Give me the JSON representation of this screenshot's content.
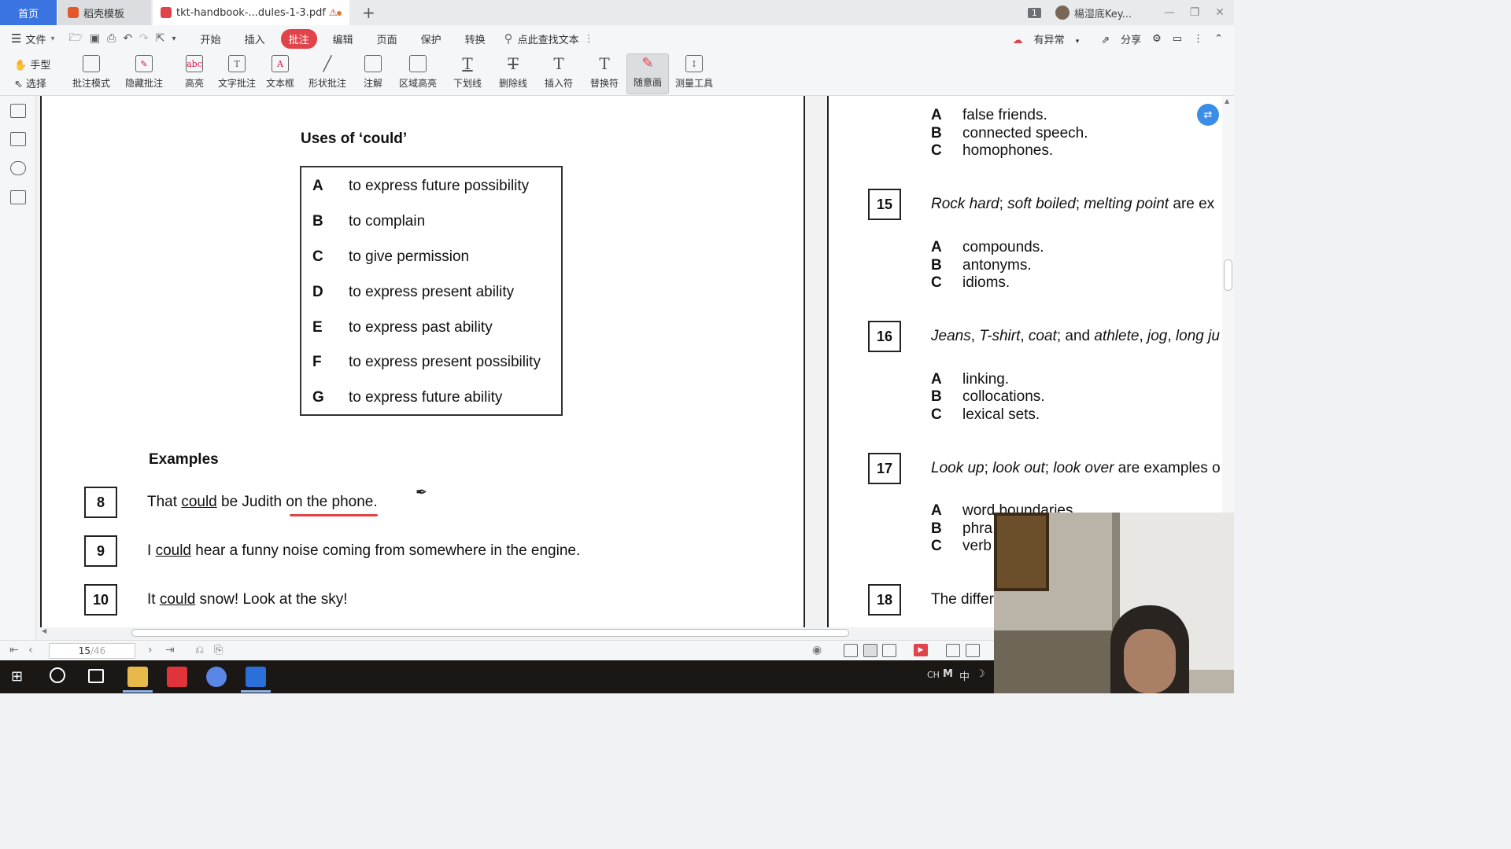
{
  "tabs": {
    "home": "首页",
    "template": "稻壳模板",
    "pdf": "tkt-handbook-...dules-1-3.pdf"
  },
  "window": {
    "count_badge": "1",
    "user_name": "楊湿底Key..."
  },
  "menu": {
    "file": "文件",
    "tabs": [
      "开始",
      "插入",
      "批注",
      "编辑",
      "页面",
      "保护",
      "转换"
    ],
    "active_tab": "批注",
    "search_placeholder": "点此查找文本",
    "right": {
      "status": "有异常",
      "share": "分享"
    }
  },
  "ribbon": {
    "hand": "手型",
    "select": "选择",
    "tools": [
      {
        "label": "批注模式",
        "icon": "annotation-mode-icon"
      },
      {
        "label": "隐藏批注",
        "icon": "hide-annotation-icon"
      },
      {
        "label": "高亮",
        "icon": "highlight-icon"
      },
      {
        "label": "文字批注",
        "icon": "text-annotation-icon"
      },
      {
        "label": "文本框",
        "icon": "textbox-icon"
      },
      {
        "label": "形状批注",
        "icon": "shape-annotation-icon"
      },
      {
        "label": "注解",
        "icon": "note-icon"
      },
      {
        "label": "区域高亮",
        "icon": "area-highlight-icon"
      },
      {
        "label": "下划线",
        "icon": "underline-icon"
      },
      {
        "label": "删除线",
        "icon": "strikethrough-icon"
      },
      {
        "label": "插入符",
        "icon": "insert-caret-icon"
      },
      {
        "label": "替换符",
        "icon": "replace-caret-icon"
      },
      {
        "label": "随意画",
        "icon": "freehand-draw-icon"
      },
      {
        "label": "测量工具",
        "icon": "measure-tool-icon"
      }
    ],
    "active_tool": "随意画"
  },
  "document": {
    "left_page": {
      "uses_title": "Uses of ‘could’",
      "uses": [
        {
          "letter": "A",
          "text": "to express future possibility"
        },
        {
          "letter": "B",
          "text": "to complain"
        },
        {
          "letter": "C",
          "text": "to give permission"
        },
        {
          "letter": "D",
          "text": "to express present ability"
        },
        {
          "letter": "E",
          "text": "to express past ability"
        },
        {
          "letter": "F",
          "text": "to express present possibility"
        },
        {
          "letter": "G",
          "text": "to express future ability"
        }
      ],
      "examples_title": "Examples",
      "examples": [
        {
          "num": "8",
          "pre": "That ",
          "could": "could",
          "post": " be Judith on the phone."
        },
        {
          "num": "9",
          "pre": "I ",
          "could": "could",
          "post": " hear a funny noise coming from somewhere in the engine."
        },
        {
          "num": "10",
          "pre": "It ",
          "could": "could",
          "post": " snow! Look at the sky!"
        }
      ]
    },
    "right_page": {
      "top_options": [
        {
          "letter": "A",
          "text": "false friends."
        },
        {
          "letter": "B",
          "text": "connected speech."
        },
        {
          "letter": "C",
          "text": "homophones."
        }
      ],
      "q15": {
        "num": "15",
        "parts": [
          "Rock hard",
          "; ",
          "soft boiled",
          "; ",
          "melting point",
          " are ex"
        ],
        "options": [
          {
            "letter": "A",
            "text": "compounds."
          },
          {
            "letter": "B",
            "text": "antonyms."
          },
          {
            "letter": "C",
            "text": "idioms."
          }
        ]
      },
      "q16": {
        "num": "16",
        "parts": [
          "Jeans",
          ", ",
          "T-shirt",
          ", ",
          "coat",
          "; and ",
          "athlete",
          ", ",
          "jog",
          ", ",
          "long ju"
        ],
        "options": [
          {
            "letter": "A",
            "text": "linking."
          },
          {
            "letter": "B",
            "text": "collocations."
          },
          {
            "letter": "C",
            "text": "lexical sets."
          }
        ]
      },
      "q17": {
        "num": "17",
        "parts": [
          "Look up",
          "; ",
          "look out",
          "; ",
          "look over",
          " are examples o"
        ],
        "options": [
          {
            "letter": "A",
            "text": "word boundaries."
          },
          {
            "letter": "B",
            "text": "phra"
          },
          {
            "letter": "C",
            "text": "verb"
          }
        ]
      },
      "q18": {
        "num": "18",
        "text": "The differ"
      }
    }
  },
  "statusbar": {
    "current_page": "15",
    "total_pages": "/46"
  },
  "taskbar": {
    "tray_lang": "CH",
    "tray_ime": "中"
  }
}
